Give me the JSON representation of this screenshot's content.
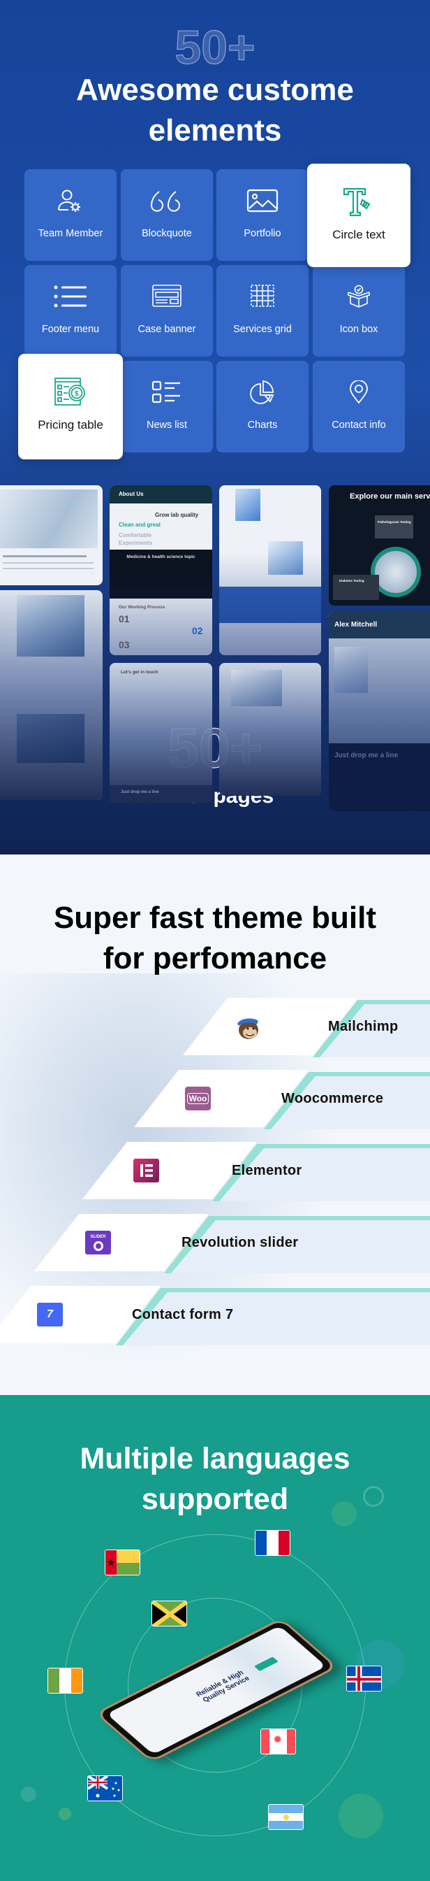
{
  "elements_section": {
    "watermark": "50+",
    "title_line1": "Awesome custome",
    "title_line2": "elements",
    "accent_color": "#3468c8",
    "items": [
      {
        "label": "Team Member",
        "icon": "user-gear-icon"
      },
      {
        "label": "Blockquote",
        "icon": "quote-icon"
      },
      {
        "label": "Portfolio",
        "icon": "image-icon"
      },
      {
        "label": "Circle text",
        "icon": "text-pen-icon",
        "highlighted": true
      },
      {
        "label": "Footer menu",
        "icon": "list-icon"
      },
      {
        "label": "Case banner",
        "icon": "browser-banner-icon"
      },
      {
        "label": "Services grid",
        "icon": "grid-icon"
      },
      {
        "label": "Icon box",
        "icon": "box-icon"
      },
      {
        "label": "Pricing table",
        "icon": "pricing-icon",
        "highlighted": true
      },
      {
        "label": "News list",
        "icon": "news-list-icon"
      },
      {
        "label": "Charts",
        "icon": "pie-chart-icon"
      },
      {
        "label": "Contact info",
        "icon": "location-pin-icon"
      }
    ]
  },
  "inner_pages": {
    "watermark": "50+",
    "title": "Inner pages",
    "previews": {
      "about": "About Us",
      "grow": "Grow lab quality",
      "clean": "Clean and great",
      "comfortable": "Comfortable Experiments",
      "medicine": "Medicine & health science topic",
      "process": "Our Working Process",
      "step1": "01",
      "step2": "02",
      "step3": "03",
      "explore": "Explore our main serv",
      "pathology": "Pathologycam Testing",
      "diabetes": "Diabetes Testing",
      "person": "Alex Mitchell",
      "drop_line": "Just drop me a line",
      "touch": "Let's get in touch",
      "drop_line2": "Just drop me a line"
    }
  },
  "performance_section": {
    "title_line1": "Super fast theme built",
    "title_line2": "for perfomance",
    "stripe_color": "#95e1d3",
    "plugins": [
      {
        "label": "Mailchimp",
        "icon": "mailchimp-icon"
      },
      {
        "label": "Woocommerce",
        "icon": "woocommerce-icon",
        "logo_text": "Woo"
      },
      {
        "label": "Elementor",
        "icon": "elementor-icon"
      },
      {
        "label": "Revolution slider",
        "icon": "revolution-slider-icon",
        "logo_text": "SLIDER"
      },
      {
        "label": "Contact form 7",
        "icon": "contact-form-7-icon",
        "logo_text": "7"
      }
    ]
  },
  "languages_section": {
    "title_line1": "Multiple languages",
    "title_line2": "supported",
    "background_color": "#169d8c",
    "flags": [
      "guinea-bissau",
      "france",
      "jamaica",
      "ireland",
      "iceland",
      "canada",
      "australia",
      "argentina"
    ],
    "phone": {
      "tagline": "Reliable & High Quality Service"
    }
  }
}
